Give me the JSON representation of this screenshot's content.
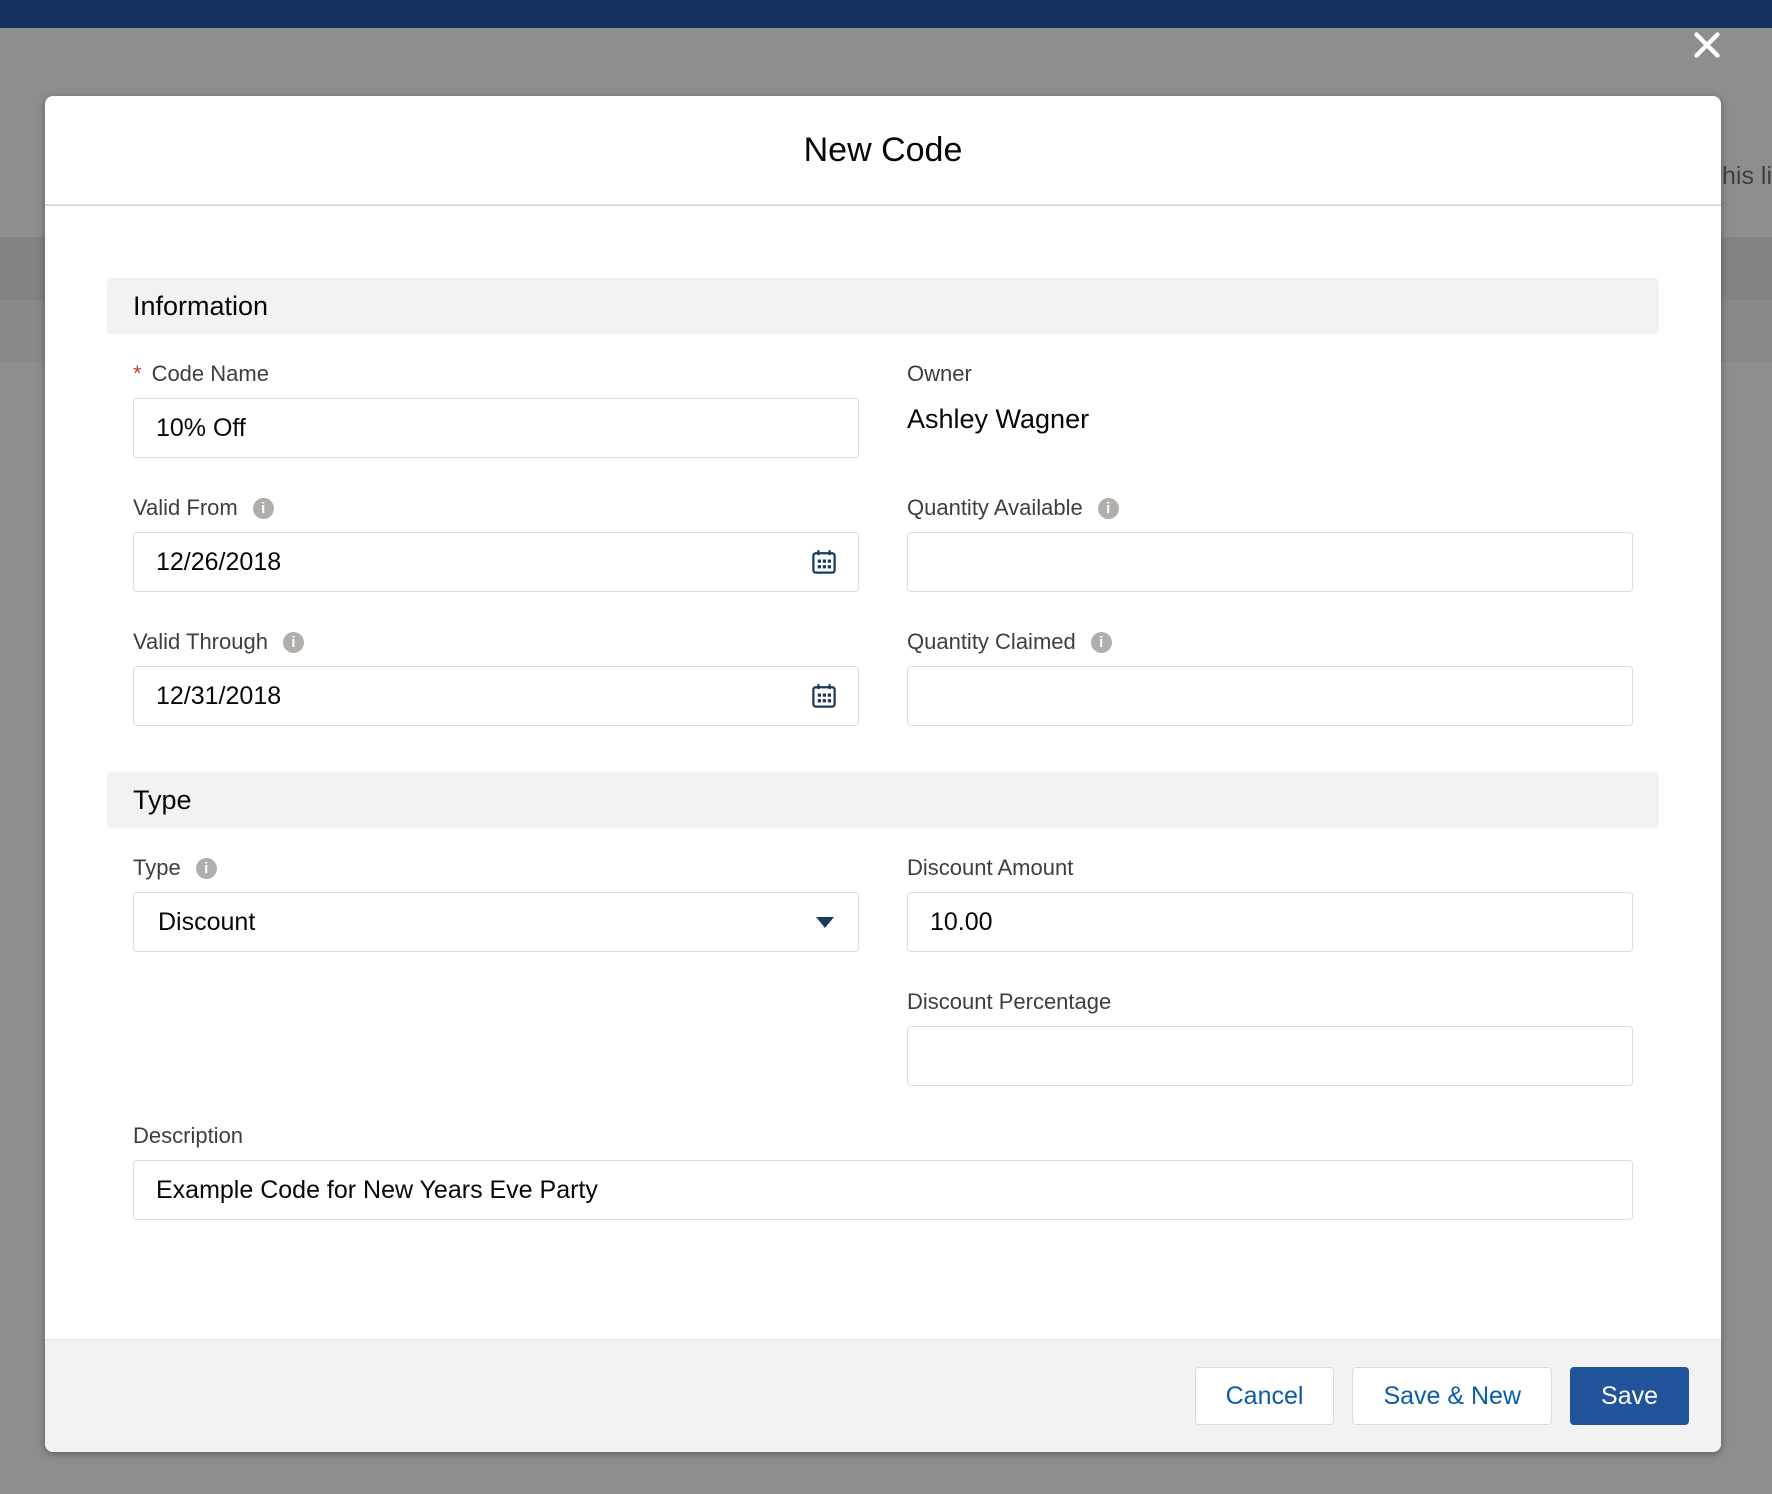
{
  "background": {
    "clipped_text": "his li"
  },
  "modal": {
    "title": "New Code"
  },
  "icons": {
    "info_glyph": "i",
    "close": "x-mark",
    "calendar": "calendar-grid",
    "dropdown": "triangle-down"
  },
  "sections": {
    "information": {
      "heading": "Information",
      "fields": {
        "code_name": {
          "label": "Code Name",
          "required_marker": "*",
          "value": "10% Off"
        },
        "owner": {
          "label": "Owner",
          "value": "Ashley Wagner"
        },
        "valid_from": {
          "label": "Valid From",
          "value": "12/26/2018"
        },
        "quantity_available": {
          "label": "Quantity Available",
          "value": ""
        },
        "valid_through": {
          "label": "Valid Through",
          "value": "12/31/2018"
        },
        "quantity_claimed": {
          "label": "Quantity Claimed",
          "value": ""
        }
      }
    },
    "type": {
      "heading": "Type",
      "fields": {
        "type": {
          "label": "Type",
          "value": "Discount"
        },
        "discount_amount": {
          "label": "Discount Amount",
          "value": "10.00"
        },
        "discount_percentage": {
          "label": "Discount Percentage",
          "value": ""
        },
        "description": {
          "label": "Description",
          "value": "Example Code for New Years Eve Party"
        }
      }
    }
  },
  "footer": {
    "cancel_label": "Cancel",
    "save_new_label": "Save & New",
    "save_label": "Save"
  },
  "colors": {
    "topbar": "#16325c",
    "overlay": "#8e8e8e",
    "section_bg": "#f3f2f2",
    "footer_bg": "#f3f2f2",
    "required": "#c23934",
    "link_text": "#0b5cab",
    "brand_button": "#22549b",
    "icon_navy": "#1b3a5e",
    "info_icon_bg": "#b0adab"
  }
}
